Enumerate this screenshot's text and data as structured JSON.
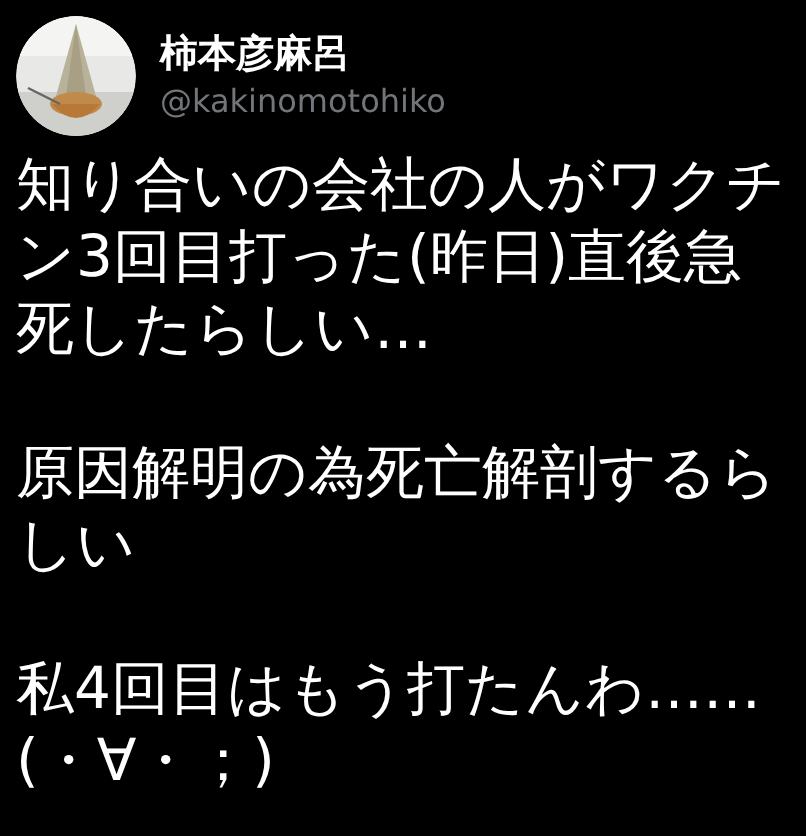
{
  "author": {
    "name": "柿本彦麻呂",
    "handle": "@kakinomotohiko"
  },
  "tweet": {
    "paragraphs": [
      "知り合いの会社の人がワクチン3回目打った(昨日)直後急死したらしい…",
      "原因解明の為死亡解剖するらしい",
      "私4回目はもう打たんわ……(・∀・；)"
    ]
  }
}
